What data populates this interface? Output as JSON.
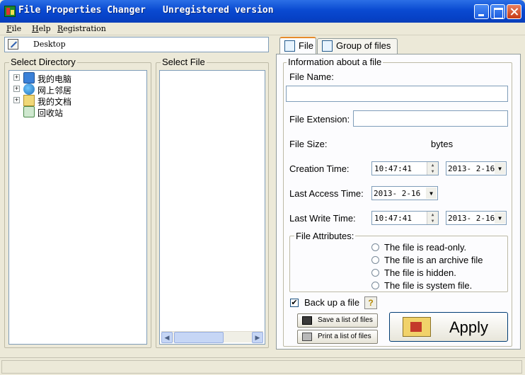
{
  "window": {
    "title": "File Properties Changer",
    "subtitle": "Unregistered version"
  },
  "menu": [
    "File",
    "Help",
    "Registration"
  ],
  "path": {
    "value": "Desktop"
  },
  "directory": {
    "label": "Select Directory",
    "items": [
      {
        "label": "我的电脑",
        "icon": "computer-icon",
        "expandable": true
      },
      {
        "label": "网上邻居",
        "icon": "network-icon",
        "expandable": true
      },
      {
        "label": "我的文档",
        "icon": "documents-icon",
        "expandable": true
      },
      {
        "label": "回收站",
        "icon": "recycle-bin-icon",
        "expandable": false
      }
    ]
  },
  "file_list": {
    "label": "Select File"
  },
  "tabs": [
    {
      "label": "File",
      "icon": "file-icon",
      "active": true
    },
    {
      "label": "Group of files",
      "icon": "group-files-icon",
      "active": false
    }
  ],
  "info": {
    "group_label": "Information about a file",
    "file_name_label": "File Name:",
    "file_name_value": "",
    "extension_label": "File Extension:",
    "extension_value": "",
    "size_label": "File Size:",
    "size_unit": "bytes",
    "creation_label": "Creation Time:",
    "creation_time": "10:47:41",
    "creation_date": "2013- 2-16",
    "access_label": "Last Access Time:",
    "access_date": "2013- 2-16",
    "write_label": "Last Write Time:",
    "write_time": "10:47:41",
    "write_date": "2013- 2-16"
  },
  "attributes": {
    "label": "File Attributes:",
    "options": [
      "The file is read-only.",
      "The file is an archive file",
      "The file is hidden.",
      "The file is system file."
    ]
  },
  "backup": {
    "label": "Back up a file",
    "checked": true
  },
  "buttons": {
    "save_list": "Save a list of files",
    "print_list": "Print a list of files",
    "apply": "Apply"
  },
  "colors": {
    "titlebar": "#0a4ad1",
    "accent_tab": "#e68b2c",
    "window_bg": "#ece9d8"
  }
}
